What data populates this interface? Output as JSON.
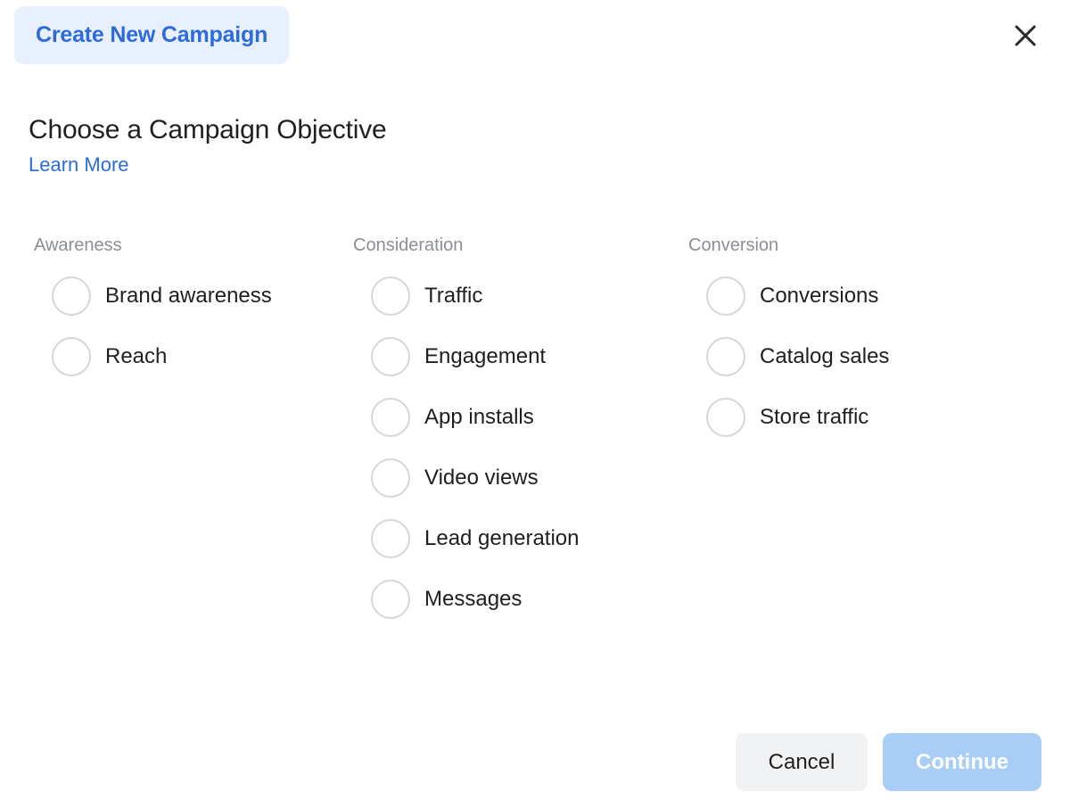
{
  "header": {
    "badge_label": "Create New Campaign",
    "badge_bg": "#e8f0fe",
    "badge_text_color": "#2d6bdd",
    "close_icon": "close-icon"
  },
  "title_block": {
    "title": "Choose a Campaign Objective",
    "learn_more_label": "Learn More",
    "link_color": "#2a6fd6"
  },
  "columns": [
    {
      "title": "Awareness",
      "options": [
        {
          "label": "Brand awareness",
          "selected": false
        },
        {
          "label": "Reach",
          "selected": false
        }
      ]
    },
    {
      "title": "Consideration",
      "options": [
        {
          "label": "Traffic",
          "selected": false
        },
        {
          "label": "Engagement",
          "selected": false
        },
        {
          "label": "App installs",
          "selected": false
        },
        {
          "label": "Video views",
          "selected": false
        },
        {
          "label": "Lead generation",
          "selected": false
        },
        {
          "label": "Messages",
          "selected": false
        }
      ]
    },
    {
      "title": "Conversion",
      "options": [
        {
          "label": "Conversions",
          "selected": false
        },
        {
          "label": "Catalog sales",
          "selected": false
        },
        {
          "label": "Store traffic",
          "selected": false
        }
      ]
    }
  ],
  "footer": {
    "cancel_label": "Cancel",
    "continue_label": "Continue",
    "continue_enabled": false,
    "continue_bg": "#a8cdf7",
    "cancel_bg": "#f1f2f3"
  }
}
